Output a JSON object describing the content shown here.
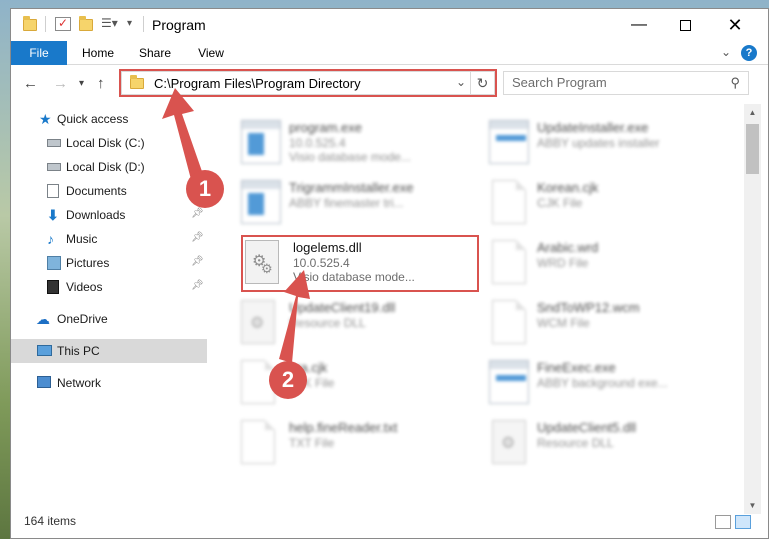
{
  "window": {
    "title": "Program"
  },
  "ribbon": {
    "tabs": [
      {
        "label": "File"
      },
      {
        "label": "Home"
      },
      {
        "label": "Share"
      },
      {
        "label": "View"
      }
    ],
    "help": "?"
  },
  "address": {
    "path": "C:\\Program Files\\Program Directory"
  },
  "search": {
    "placeholder": "Search Program"
  },
  "sidebar": {
    "items": [
      {
        "label": "Quick access",
        "icon": "star-icon"
      },
      {
        "label": "Local Disk (C:)",
        "icon": "disk-icon"
      },
      {
        "label": "Local Disk (D:)",
        "icon": "disk-icon"
      },
      {
        "label": "Documents",
        "icon": "documents-icon"
      },
      {
        "label": "Downloads",
        "icon": "downloads-icon"
      },
      {
        "label": "Music",
        "icon": "music-icon"
      },
      {
        "label": "Pictures",
        "icon": "pictures-icon"
      },
      {
        "label": "Videos",
        "icon": "videos-icon"
      },
      {
        "label": "OneDrive",
        "icon": "cloud-icon"
      },
      {
        "label": "This PC",
        "icon": "computer-icon",
        "selected": true
      },
      {
        "label": "Network",
        "icon": "network-icon"
      }
    ]
  },
  "files": [
    {
      "name": "program.exe",
      "line1": "10.0.525.4",
      "line2": "Visio database mode...",
      "icon": "app"
    },
    {
      "name": "UpdateInstaller.exe",
      "line1": "ABBY updates installer",
      "line2": "",
      "icon": "app"
    },
    {
      "name": "TrigrammInstaller.exe",
      "line1": "ABBY finemaster tri...",
      "line2": "",
      "icon": "app"
    },
    {
      "name": "Korean.cjk",
      "line1": "CJK File",
      "line2": "",
      "icon": "page"
    },
    {
      "name": "logelems.dll",
      "line1": "10.0.525.4",
      "line2": "Visio database mode...",
      "icon": "gear"
    },
    {
      "name": "Arabic.wrd",
      "line1": "WRD File",
      "line2": "",
      "icon": "page"
    },
    {
      "name": "UpdateClient19.dll",
      "line1": "Resource DLL",
      "line2": "",
      "icon": "gear"
    },
    {
      "name": "SndToWP12.wcm",
      "line1": "WCM File",
      "line2": "",
      "icon": "page"
    },
    {
      "name": "ara.cjk",
      "line1": "CJK File",
      "line2": "",
      "icon": "page"
    },
    {
      "name": "FineExec.exe",
      "line1": "ABBY background exe...",
      "line2": "",
      "icon": "app"
    },
    {
      "name": "help.fineReader.txt",
      "line1": "TXT File",
      "line2": "",
      "icon": "page"
    },
    {
      "name": "UpdateClient5.dll",
      "line1": "Resource DLL",
      "line2": "",
      "icon": "gear"
    }
  ],
  "status": {
    "count": "164 items"
  },
  "annotations": {
    "step1": "1",
    "step2": "2",
    "color": "#d9534f"
  },
  "colors": {
    "accent": "#1979ca",
    "highlight": "#d9534f"
  }
}
